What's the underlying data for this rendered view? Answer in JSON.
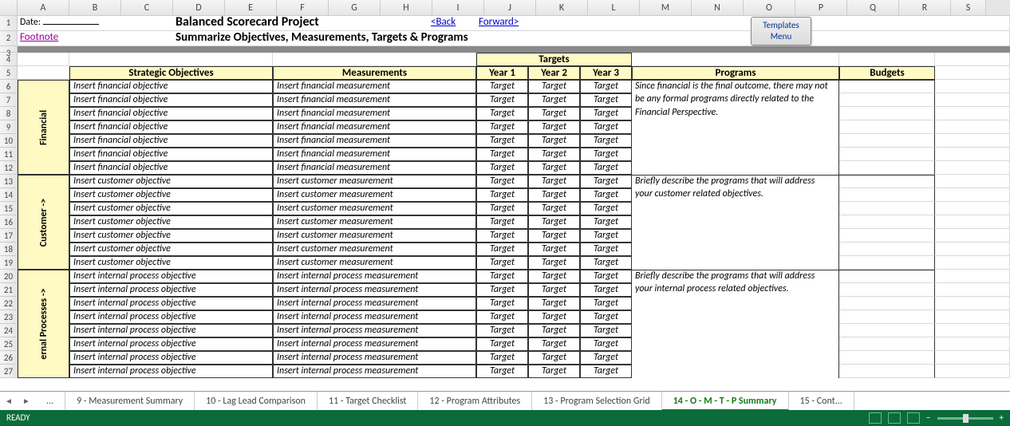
{
  "columns": [
    "A",
    "B",
    "C",
    "D",
    "E",
    "F",
    "G",
    "H",
    "I",
    "J",
    "K",
    "L",
    "M",
    "N",
    "O",
    "P",
    "Q",
    "R",
    "S"
  ],
  "rows": [
    "1",
    "2",
    "3",
    "4",
    "5",
    "6",
    "7",
    "8",
    "9",
    "10",
    "11",
    "12",
    "13",
    "14",
    "15",
    "16",
    "17",
    "18",
    "19",
    "20",
    "21",
    "22",
    "23",
    "24",
    "25",
    "26",
    "27"
  ],
  "date_label": "Date:",
  "title": "Balanced Scorecard Project",
  "subtitle": "Summarize Objectives, Measurements, Targets & Programs",
  "back": "<Back",
  "forward": "Forward>",
  "footnote": "Footnote",
  "templates_btn": "Templates Menu",
  "hdr": {
    "targets": "Targets",
    "strategic": "Strategic Objectives",
    "measurements": "Measurements",
    "y1": "Year 1",
    "y2": "Year 2",
    "y3": "Year 3",
    "programs": "Programs",
    "budgets": "Budgets"
  },
  "sections": [
    {
      "label": "Financial",
      "objective": "Insert financial objective",
      "measurement": "Insert financial measurement",
      "target": "Target",
      "program_lines": [
        "Since financial is the final outcome, there may not",
        "be any formal programs directly related to the",
        "Financial Perspective."
      ],
      "rows": 7
    },
    {
      "label": "Customer ->",
      "objective": "Insert customer objective",
      "measurement": "Insert customer measurement",
      "target": "Target",
      "program_lines": [
        "Briefly describe the programs that will address",
        "your customer related objectives."
      ],
      "rows": 7
    },
    {
      "label": "ernal Processes ->",
      "objective": "Insert internal process objective",
      "measurement": "Insert internal process measurement",
      "target": "Target",
      "program_lines": [
        "Briefly describe the programs that will address",
        "your internal process related objectives."
      ],
      "rows": 8
    }
  ],
  "tabs": {
    "ellipsis": "...",
    "list": [
      "9 - Measurement Summary",
      "10 - Lag Lead Comparison",
      "11 - Target Checklist",
      "12 - Program Attributes",
      "13 - Program Selection Grid",
      "14 - O - M - T - P Summary",
      "15 - Cont..."
    ],
    "active": "14 - O - M - T - P Summary"
  },
  "status": "READY"
}
